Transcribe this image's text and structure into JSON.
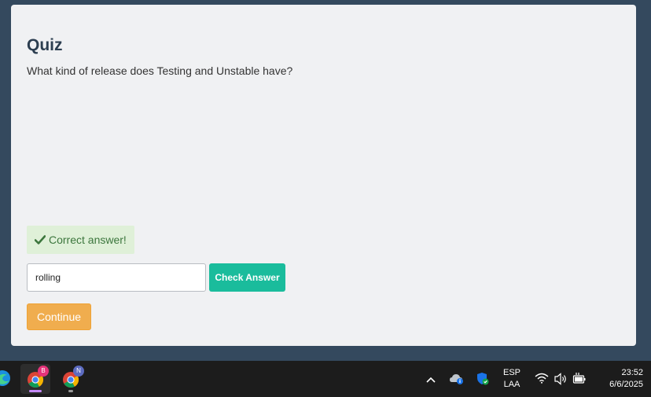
{
  "quiz": {
    "title": "Quiz",
    "question": "What kind of release does Testing and Unstable have?",
    "feedback": "Correct answer!",
    "answer_value": "rolling",
    "check_label": "Check Answer",
    "continue_label": "Continue"
  },
  "taskbar": {
    "apps": [
      {
        "name": "edge-icon"
      },
      {
        "name": "chrome-icon",
        "badge": "B",
        "active": true
      },
      {
        "name": "chrome-icon",
        "badge": "N",
        "active": false
      }
    ],
    "tray": {
      "language_line1": "ESP",
      "language_line2": "LAA",
      "time": "23:52",
      "date": "6/6/2025"
    }
  },
  "colors": {
    "background": "#34495e",
    "card": "#f0f1f3",
    "success_bg": "#dff0d8",
    "success_text": "#3c763d",
    "check_button": "#1abc9c",
    "continue_button": "#f0ad4e"
  }
}
